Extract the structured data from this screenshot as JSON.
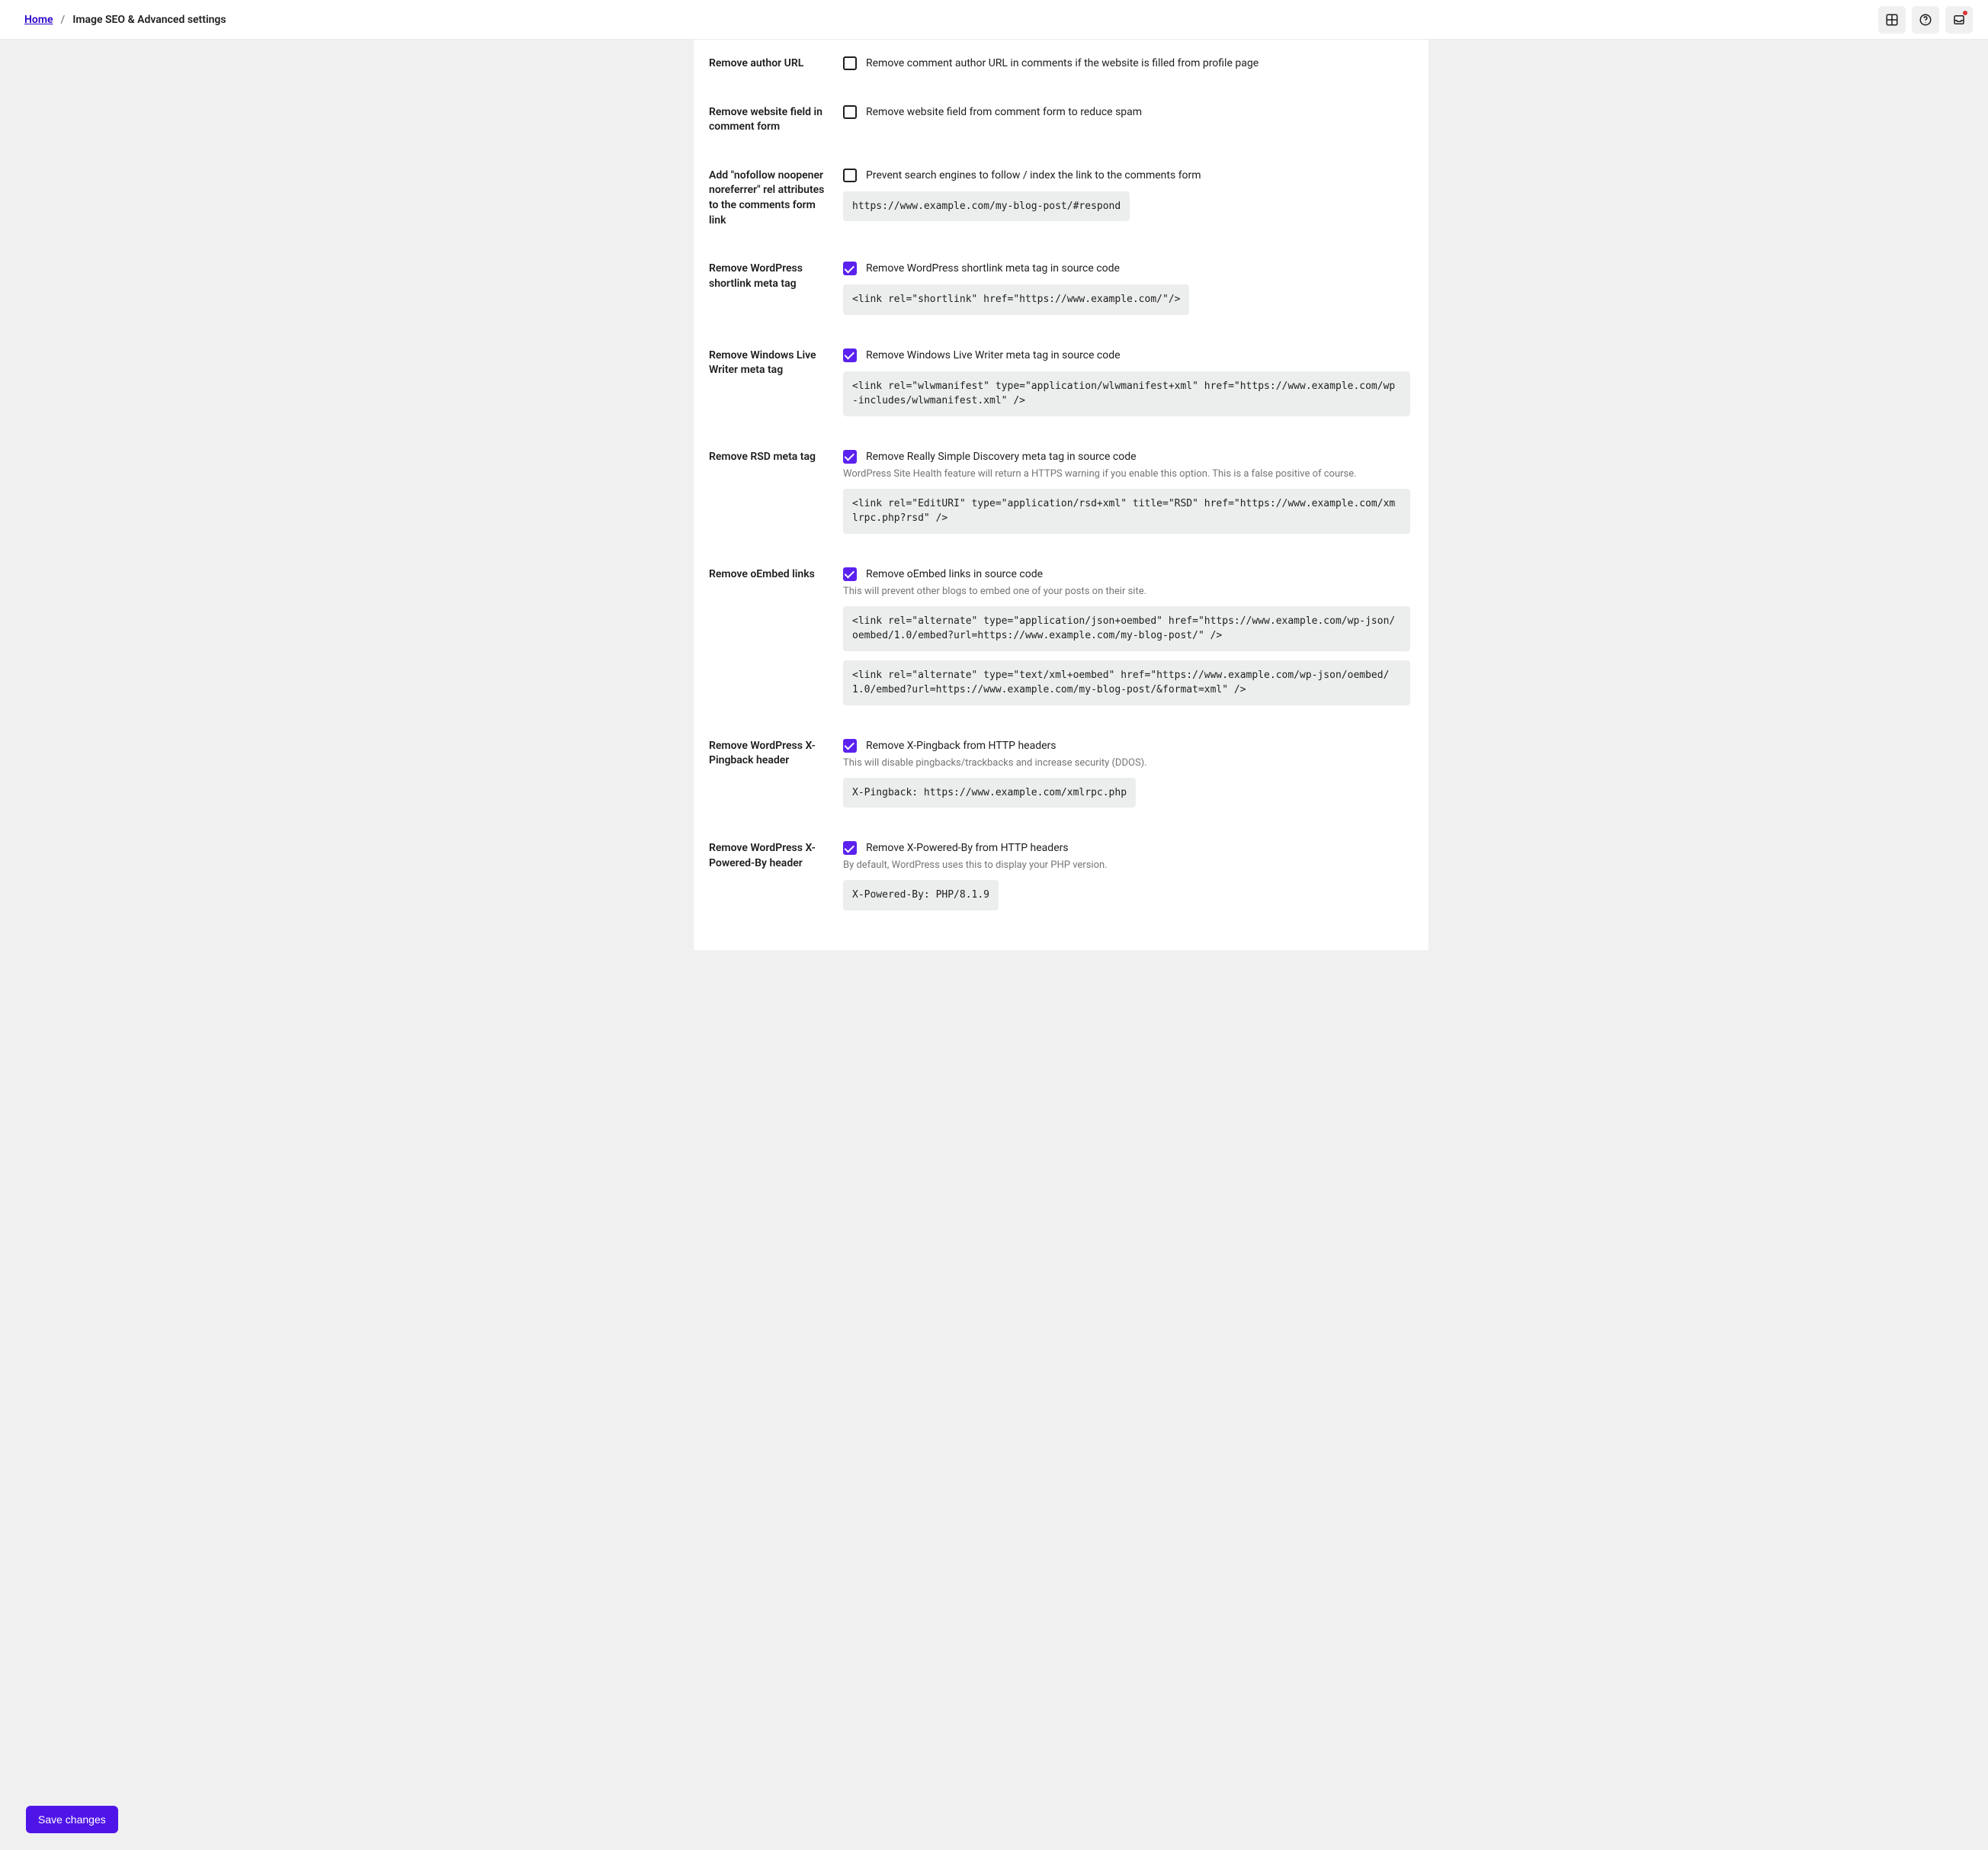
{
  "breadcrumb": {
    "home": "Home",
    "separator": "/",
    "current": "Image SEO & Advanced settings"
  },
  "save_button": "Save changes",
  "rows": {
    "author_url": {
      "label": "Remove author URL",
      "check_text": "Remove comment author URL in comments if the website is filled from profile page",
      "checked": false
    },
    "website_field": {
      "label": "Remove website field in comment form",
      "check_text": "Remove website field from comment form to reduce spam",
      "checked": false
    },
    "nofollow": {
      "label": "Add \"nofollow noopener noreferrer\" rel attributes to the comments form link",
      "check_text": "Prevent search engines to follow / index the link to the comments form",
      "checked": false,
      "code": "https://www.example.com/my-blog-post/#respond"
    },
    "shortlink": {
      "label": "Remove WordPress shortlink meta tag",
      "check_text": "Remove WordPress shortlink meta tag in source code",
      "checked": true,
      "code": "<link rel=\"shortlink\" href=\"https://www.example.com/\"/>"
    },
    "wlw": {
      "label": "Remove Windows Live Writer meta tag",
      "check_text": "Remove Windows Live Writer meta tag in source code",
      "checked": true,
      "code": "<link rel=\"wlwmanifest\" type=\"application/wlwmanifest+xml\" href=\"https://www.example.com/wp-includes/wlwmanifest.xml\" />"
    },
    "rsd": {
      "label": "Remove RSD meta tag",
      "check_text": "Remove Really Simple Discovery meta tag in source code",
      "checked": true,
      "helper": "WordPress Site Health feature will return a HTTPS warning if you enable this option. This is a false positive of course.",
      "code": "<link rel=\"EditURI\" type=\"application/rsd+xml\" title=\"RSD\" href=\"https://www.example.com/xmlrpc.php?rsd\" />"
    },
    "oembed": {
      "label": "Remove oEmbed links",
      "check_text": "Remove oEmbed links in source code",
      "checked": true,
      "helper": "This will prevent other blogs to embed one of your posts on their site.",
      "code1": "<link rel=\"alternate\" type=\"application/json+oembed\" href=\"https://www.example.com/wp-json/oembed/1.0/embed?url=https://www.example.com/my-blog-post/\" />",
      "code2": "<link rel=\"alternate\" type=\"text/xml+oembed\" href=\"https://www.example.com/wp-json/oembed/1.0/embed?url=https://www.example.com/my-blog-post/&format=xml\" />"
    },
    "xpingback": {
      "label": "Remove WordPress X-Pingback header",
      "check_text": "Remove X-Pingback from HTTP headers",
      "checked": true,
      "helper": "This will disable pingbacks/trackbacks and increase security (DDOS).",
      "code": "X-Pingback: https://www.example.com/xmlrpc.php"
    },
    "xpowered": {
      "label": "Remove WordPress X-Powered-By header",
      "check_text": "Remove X-Powered-By from HTTP headers",
      "checked": true,
      "helper": "By default, WordPress uses this to display your PHP version.",
      "code": "X-Powered-By: PHP/8.1.9"
    }
  }
}
